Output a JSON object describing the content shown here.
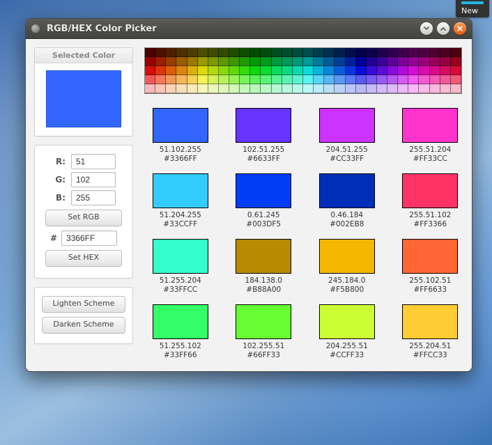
{
  "desktop": {
    "panel_label": "New"
  },
  "window": {
    "title": "RGB/HEX Color Picker"
  },
  "sidebar": {
    "selected_header": "Selected Color",
    "selected_color": "#3366FF",
    "r_label": "R:",
    "g_label": "G:",
    "b_label": "B:",
    "r_value": "51",
    "g_value": "102",
    "b_value": "255",
    "set_rgb_label": "Set RGB",
    "hash": "#",
    "hex_value": "3366FF",
    "set_hex_label": "Set HEX",
    "lighten_label": "Lighten Scheme",
    "darken_label": "Darken Scheme"
  },
  "swatches": [
    {
      "color": "#3366FF",
      "rgb": "51.102.255",
      "hex": "#3366FF"
    },
    {
      "color": "#6633FF",
      "rgb": "102.51.255",
      "hex": "#6633FF"
    },
    {
      "color": "#CC33FF",
      "rgb": "204.51.255",
      "hex": "#CC33FF"
    },
    {
      "color": "#FF33CC",
      "rgb": "255.51.204",
      "hex": "#FF33CC"
    },
    {
      "color": "#33CCFF",
      "rgb": "51.204.255",
      "hex": "#33CCFF"
    },
    {
      "color": "#003DF5",
      "rgb": "0.61.245",
      "hex": "#003DF5"
    },
    {
      "color": "#002EB8",
      "rgb": "0.46.184",
      "hex": "#002EB8"
    },
    {
      "color": "#FF3366",
      "rgb": "255.51.102",
      "hex": "#FF3366"
    },
    {
      "color": "#33FFCC",
      "rgb": "51.255.204",
      "hex": "#33FFCC"
    },
    {
      "color": "#B88A00",
      "rgb": "184.138.0",
      "hex": "#B88A00"
    },
    {
      "color": "#F5B800",
      "rgb": "245.184.0",
      "hex": "#F5B800"
    },
    {
      "color": "#FF6633",
      "rgb": "255.102.51",
      "hex": "#FF6633"
    },
    {
      "color": "#33FF66",
      "rgb": "51.255.102",
      "hex": "#33FF66"
    },
    {
      "color": "#66FF33",
      "rgb": "102.255.51",
      "hex": "#66FF33"
    },
    {
      "color": "#CCFF33",
      "rgb": "204.255.51",
      "hex": "#CCFF33"
    },
    {
      "color": "#FFCC33",
      "rgb": "255.204.51",
      "hex": "#FFCC33"
    }
  ],
  "palette_hues": [
    0,
    12,
    24,
    36,
    48,
    60,
    72,
    84,
    96,
    108,
    120,
    132,
    144,
    156,
    168,
    180,
    192,
    204,
    216,
    228,
    240,
    252,
    264,
    276,
    288,
    300,
    312,
    324,
    336,
    348
  ]
}
